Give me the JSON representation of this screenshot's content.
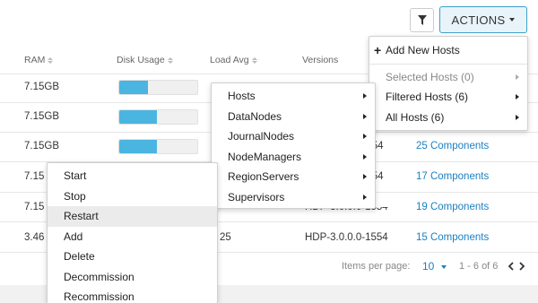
{
  "toolbar": {
    "filter_icon": "filter-icon",
    "actions_label": "ACTIONS"
  },
  "table": {
    "headers": {
      "ram": "RAM",
      "disk": "Disk Usage",
      "load": "Load Avg",
      "versions": "Versions"
    },
    "rows": [
      {
        "ram": "7.15GB",
        "disk_fraction": 0.37,
        "load": "",
        "version": "",
        "components": ""
      },
      {
        "ram": "7.15GB",
        "disk_fraction": 0.48,
        "load": "",
        "version": "",
        "components": ""
      },
      {
        "ram": "7.15GB",
        "disk_fraction": 0.48,
        "load": "",
        "version": "1554",
        "components": "25 Components"
      },
      {
        "ram": "7.15",
        "disk_fraction": null,
        "load": "",
        "version": "1554",
        "components": "17 Components"
      },
      {
        "ram": "7.15",
        "disk_fraction": null,
        "load": "",
        "version": "HDP-3.0.0.0-1554",
        "components": "19 Components"
      },
      {
        "ram": "3.46",
        "disk_fraction": null,
        "load": "25",
        "version": "HDP-3.0.0.0-1554",
        "components": "15 Components"
      }
    ]
  },
  "pagination": {
    "items_per_page_label": "Items per page:",
    "items_per_page_value": "10",
    "range": "1 - 6 of 6"
  },
  "actions_menu": {
    "add_hosts": "Add New Hosts",
    "selected_hosts": "Selected Hosts (0)",
    "filtered_hosts": "Filtered Hosts (6)",
    "all_hosts": "All Hosts (6)"
  },
  "submenu_components": [
    "Hosts",
    "DataNodes",
    "JournalNodes",
    "NodeManagers",
    "RegionServers",
    "Supervisors"
  ],
  "submenu_operations": [
    "Start",
    "Stop",
    "Restart",
    "Add",
    "Delete",
    "Decommission",
    "Recommission"
  ],
  "colors": {
    "accent": "#3aa1c9",
    "link": "#1a7fc1",
    "bar_fill": "#4ab5e0"
  }
}
